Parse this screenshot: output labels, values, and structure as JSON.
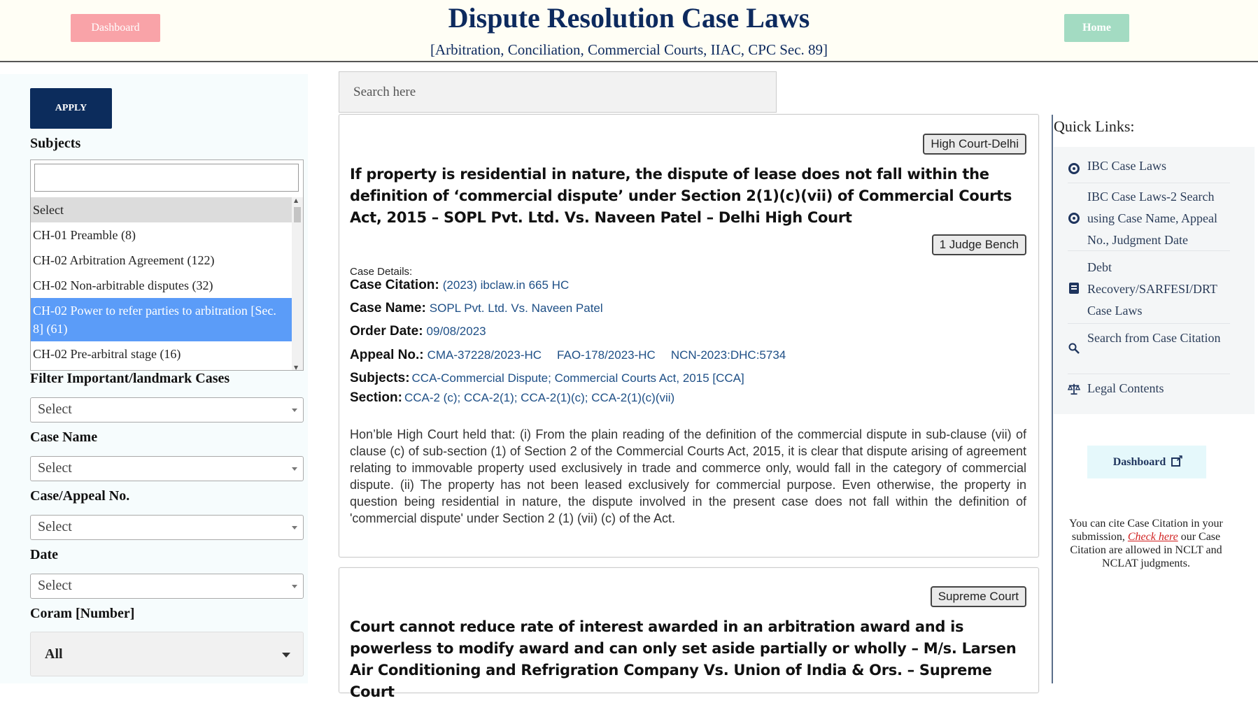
{
  "header": {
    "title": "Dispute Resolution Case Laws",
    "subtitle": "[Arbitration, Conciliation, Commercial Courts, IIAC, CPC Sec. 89]",
    "dashboard_label": "Dashboard",
    "home_label": "Home"
  },
  "sidebar": {
    "apply_label": "APPLY",
    "subjects_label": "Subjects",
    "subjects_placeholder": "Select",
    "subjects_options": [
      "CH-01 Preamble  (8)",
      "CH-02 Arbitration Agreement  (122)",
      "CH-02 Non-arbitrable disputes  (32)",
      "CH-02 Power to refer parties to arbitration [Sec. 8]  (61)",
      "CH-02 Pre-arbitral stage  (16)"
    ],
    "selected_option_index": 3,
    "important_label": "Filter Important/landmark Cases",
    "important_value": "Select",
    "case_name_label": "Case Name",
    "case_name_value": "Select",
    "case_no_label": "Case/Appeal No.",
    "case_no_value": "Select",
    "date_label": "Date",
    "date_value": "Select",
    "coram_label": "Coram [Number]",
    "coram_value": "All"
  },
  "search": {
    "placeholder": "Search here"
  },
  "cards": [
    {
      "court": "High Court-Delhi",
      "title": "If property is residential in nature, the dispute of lease does not fall within the definition of ‘commercial dispute’ under Section 2(1)(c)(vii) of Commercial Courts Act, 2015 – SOPL Pvt. Ltd. Vs. Naveen Patel – Delhi High Court",
      "bench": "1 Judge Bench",
      "details_label": "Case Details:",
      "citation_label": "Case Citation:",
      "citation": "(2023) ibclaw.in 665 HC",
      "case_name_label": "Case Name:",
      "case_name": "SOPL Pvt. Ltd. Vs. Naveen Patel",
      "order_date_label": "Order Date:",
      "order_date": "09/08/2023",
      "appeal_label": "Appeal No.:",
      "appeal_nos": [
        "CMA-37228/2023-HC",
        "FAO-178/2023-HC",
        "NCN-2023:DHC:5734"
      ],
      "subjects_label": "Subjects:",
      "subjects": "CCA-Commercial Dispute; Commercial Courts Act, 2015 [CCA]",
      "section_label": "Section:",
      "section": "CCA-2 (c); CCA-2(1); CCA-2(1)(c); CCA-2(1)(c)(vii)",
      "summary": "Hon’ble High Court held that: (i) From the plain reading of the definition of the commercial dispute in sub-clause (vii) of clause (c) of sub-section (1) of Section 2 of the Commercial Courts Act, 2015, it is clear that dispute arising of agreement relating to immovable property used exclusively in trade and commerce only, would fall in the category of commercial dispute. (ii) The property has not been leased exclusively for commercial purpose. Even otherwise, the property in question being residential in nature, the dispute involved in the present case does not fall within the definition of 'commercial dispute' under Section 2 (1) (vii) (c) of the Act."
    },
    {
      "court": "Supreme Court",
      "title": "Court cannot reduce rate of interest awarded in an arbitration award and is powerless to modify award and can only set aside partially or wholly – M/s. Larsen Air Conditioning and Refrigration Company Vs. Union of India & Ors. – Supreme Court"
    }
  ],
  "quick_links": {
    "title": "Quick Links:",
    "items": [
      {
        "label": "IBC Case Laws",
        "icon": "target-icon"
      },
      {
        "label": "IBC Case Laws-2 Search using Case Name, Appeal No., Judgment Date",
        "icon": "target-icon"
      },
      {
        "label": "Debt Recovery/SARFESI/DRT Case Laws",
        "icon": "book-icon"
      },
      {
        "label": "Search from Case Citation",
        "icon": "magnifier-icon"
      },
      {
        "label": "Legal Contents",
        "icon": "scales-icon"
      }
    ]
  },
  "right_dashboard_label": "Dashboard",
  "cite_note": {
    "before": "You can cite Case Citation in your submission, ",
    "link": "Check here",
    "after": " our Case Citation are allowed in NCLT and NCLAT judgments."
  },
  "colors": {
    "title_navy": "#0d2a5e",
    "apply_navy": "#0c2c5c",
    "dashboard_pink": "#f9a3a8",
    "home_green": "#a3dbc2",
    "selected_blue": "#5b9cf8",
    "value_blue": "#1e4f86",
    "link_red": "#d02020"
  }
}
